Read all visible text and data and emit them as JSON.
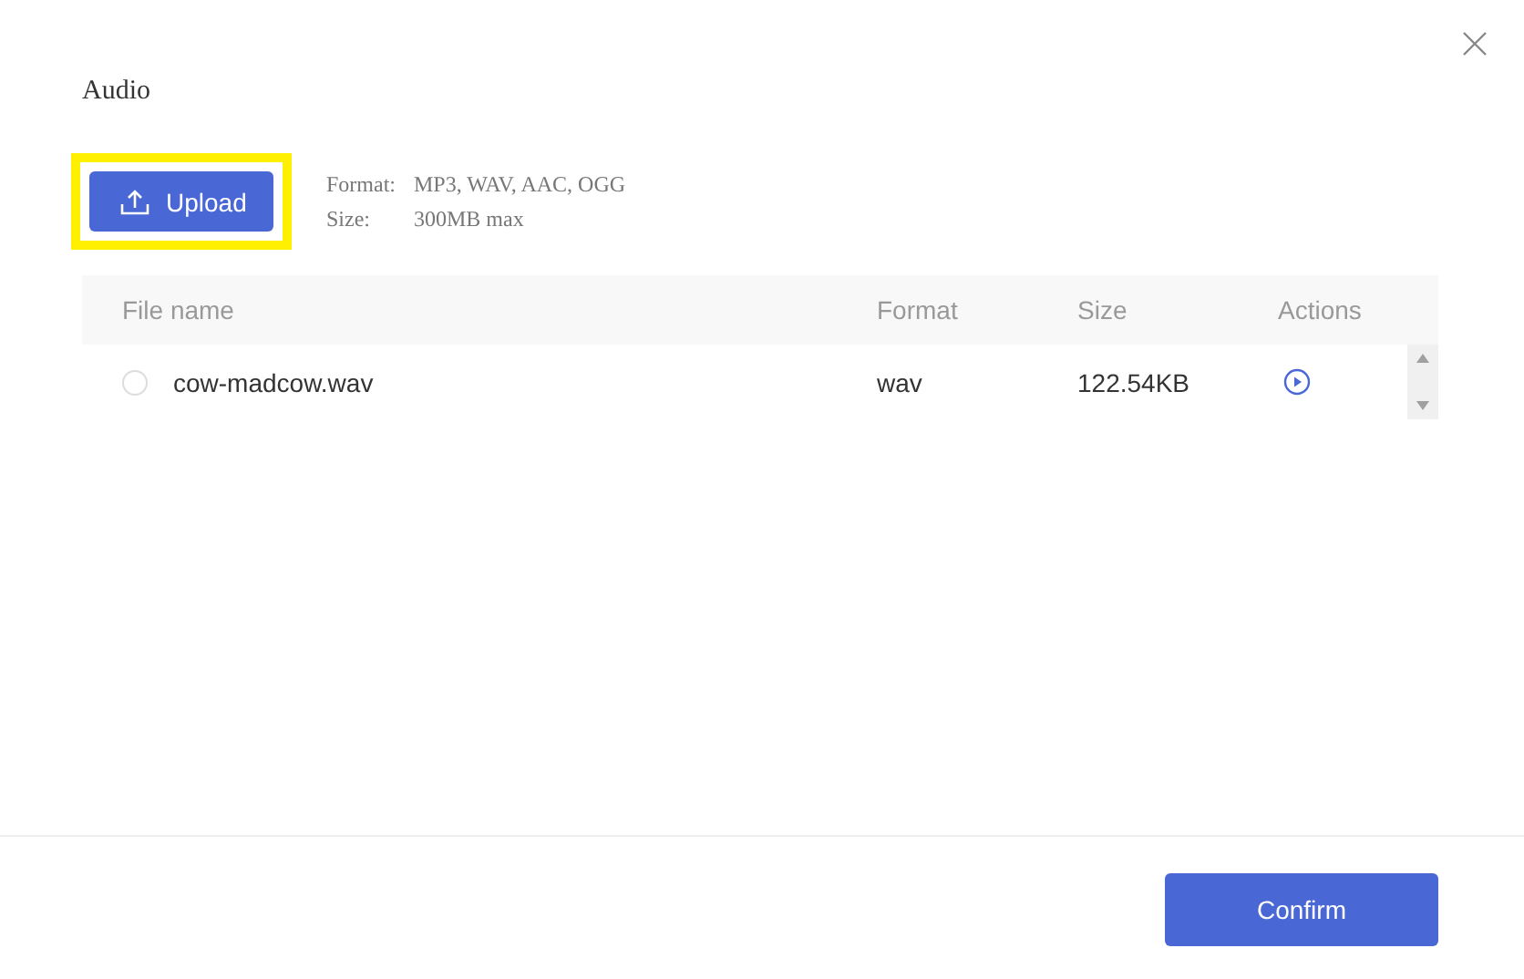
{
  "dialog": {
    "title": "Audio"
  },
  "upload": {
    "label": "Upload",
    "highlighted": true
  },
  "info": [
    {
      "label": "Format:",
      "value": "MP3, WAV, AAC, OGG"
    },
    {
      "label": "Size:",
      "value": "300MB max"
    }
  ],
  "table": {
    "columns": [
      "File name",
      "Format",
      "Size",
      "Actions"
    ],
    "rows": [
      {
        "name": "cow-madcow.wav",
        "format": "wav",
        "size": "122.54KB",
        "selected": false
      }
    ]
  },
  "buttons": {
    "confirm": "Confirm"
  }
}
